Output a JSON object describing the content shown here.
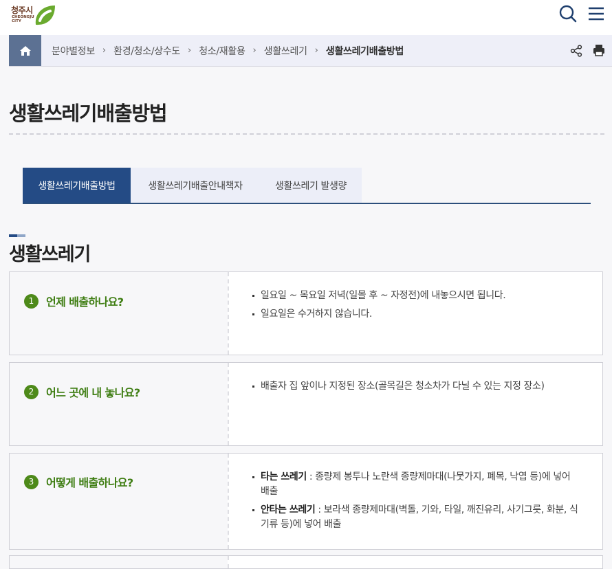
{
  "header": {
    "logo_ko": "청주시",
    "logo_en_line1": "CHEONGJU",
    "logo_en_line2": "CITY",
    "search_icon": "search-icon",
    "menu_icon": "hamburger-menu-icon"
  },
  "breadcrumb": {
    "home_icon": "home-icon",
    "items": [
      "분야별정보",
      "환경/청소/상수도",
      "청소/재활용",
      "생활쓰레기",
      "생활쓰레기배출방법"
    ],
    "separator": "›",
    "share_icon": "share-icon",
    "print_icon": "print-icon"
  },
  "page_title": "생활쓰레기배출방법",
  "tabs": [
    {
      "label": "생활쓰레기배출방법",
      "active": true
    },
    {
      "label": "생활쓰레기배출안내책자",
      "active": false
    },
    {
      "label": "생활쓰레기 발생량",
      "active": false
    }
  ],
  "section_title": "생활쓰레기",
  "qa": [
    {
      "number": "1",
      "question": "언제 배출하나요?",
      "answers": [
        {
          "lead": "",
          "text": "일요일 ~ 목요일 저녁(일몰 후 ~ 자정전)에 내놓으시면 됩니다."
        },
        {
          "lead": "",
          "text": "일요일은 수거하지 않습니다."
        }
      ]
    },
    {
      "number": "2",
      "question": "어느 곳에 내 놓나요?",
      "answers": [
        {
          "lead": "",
          "text": "배출자 집 앞이나 지정된 장소(골목길은 청소차가 다닐 수 있는 지정 장소)"
        }
      ]
    },
    {
      "number": "3",
      "question": "어떻게 배출하나요?",
      "answers": [
        {
          "lead": "타는 쓰레기",
          "text": " : 종량제 봉투나 노란색 종량제마대(나뭇가지, 폐목, 낙엽 등)에 넣어 배출"
        },
        {
          "lead": "안타는 쓰레기",
          "text": " : 보라색 종량제마대(벽돌, 기와, 타일, 깨진유리, 사기그릇, 화분, 식기류 등)에 넣어 배출"
        }
      ]
    }
  ],
  "colors": {
    "accent_navy": "#244b85",
    "home_button": "#5c7193",
    "question_green": "#3e7d12",
    "logo_green": "#6aaa2e"
  }
}
